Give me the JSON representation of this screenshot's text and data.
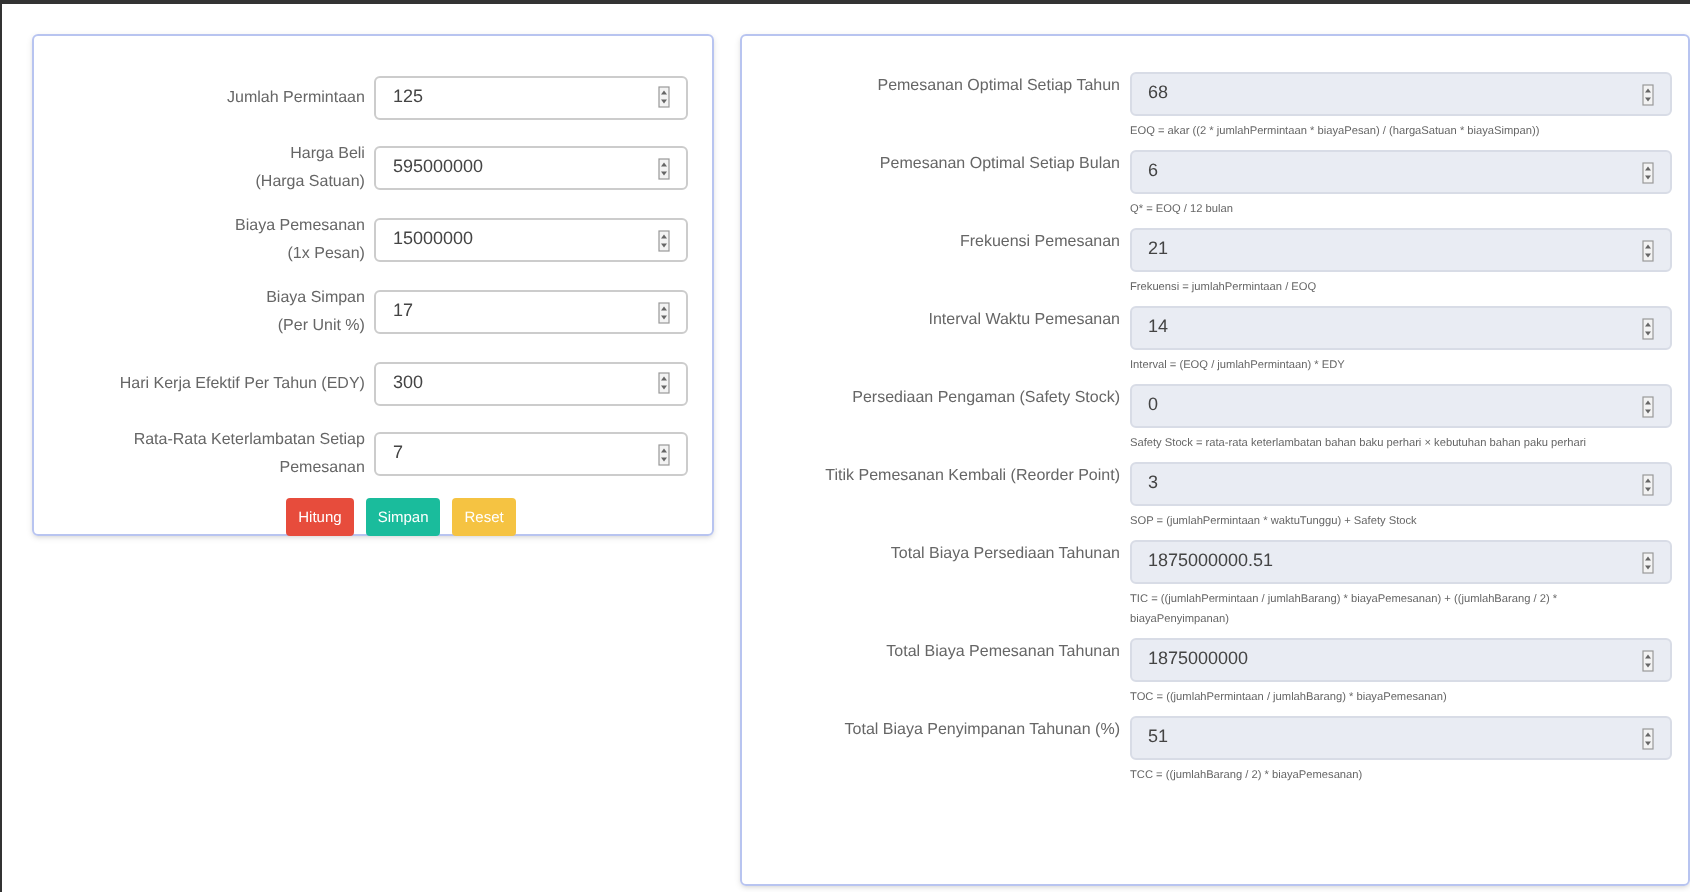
{
  "input_form": {
    "fields": [
      {
        "label": [
          "Jumlah Permintaan"
        ],
        "value": "125",
        "readonly": false
      },
      {
        "label": [
          "Harga Beli",
          "(Harga Satuan)"
        ],
        "value": "595000000",
        "readonly": false
      },
      {
        "label": [
          "Biaya Pemesanan",
          "(1x Pesan)"
        ],
        "value": "15000000",
        "readonly": false
      },
      {
        "label": [
          "Biaya Simpan",
          "(Per Unit %)"
        ],
        "value": "17",
        "readonly": false
      },
      {
        "label": [
          "Hari Kerja Efektif Per Tahun (EDY)"
        ],
        "value": "300",
        "readonly": false
      },
      {
        "label": [
          "Rata-Rata Keterlambatan Setiap",
          "Pemesanan"
        ],
        "value": "7",
        "readonly": false
      }
    ],
    "buttons": [
      {
        "label": "Hitung",
        "color": "#e74c3c"
      },
      {
        "label": "Simpan",
        "color": "#1abc9c"
      },
      {
        "label": "Reset",
        "color": "#f5c342"
      }
    ]
  },
  "results": {
    "fields": [
      {
        "label": "Pemesanan Optimal Setiap Tahun",
        "value": "68",
        "readonly": true,
        "hint": "EOQ = akar ((2 * jumlahPermintaan * biayaPesan) / (hargaSatuan * biayaSimpan))"
      },
      {
        "label": "Pemesanan Optimal Setiap Bulan",
        "value": "6",
        "readonly": true,
        "hint": "Q* = EOQ / 12 bulan"
      },
      {
        "label": "Frekuensi Pemesanan",
        "value": "21",
        "readonly": true,
        "hint": "Frekuensi = jumlahPermintaan / EOQ"
      },
      {
        "label": "Interval Waktu Pemesanan",
        "value": "14",
        "readonly": true,
        "hint": "Interval = (EOQ / jumlahPermintaan) * EDY"
      },
      {
        "label": "Persediaan Pengaman (Safety Stock)",
        "value": "0",
        "readonly": true,
        "hint": "Safety Stock = rata-rata keterlambatan bahan baku perhari × kebutuhan bahan paku perhari"
      },
      {
        "label": "Titik Pemesanan Kembali (Reorder Point)",
        "value": "3",
        "readonly": true,
        "hint": "SOP = (jumlahPermintaan * waktuTunggu) + Safety Stock"
      },
      {
        "label": "Total Biaya Persediaan Tahunan",
        "value": "1875000000.51",
        "readonly": true,
        "hint": "TIC = ((jumlahPermintaan / jumlahBarang) * biayaPemesanan) + ((jumlahBarang / 2) * biayaPenyimpanan)"
      },
      {
        "label": "Total Biaya Pemesanan Tahunan",
        "value": "1875000000",
        "readonly": true,
        "hint": "TOC = ((jumlahPermintaan / jumlahBarang) * biayaPemesanan)"
      },
      {
        "label": "Total Biaya Penyimpanan Tahunan (%)",
        "value": "51",
        "readonly": true,
        "hint": "TCC = ((jumlahBarang / 2) * biayaPemesanan)"
      }
    ]
  }
}
